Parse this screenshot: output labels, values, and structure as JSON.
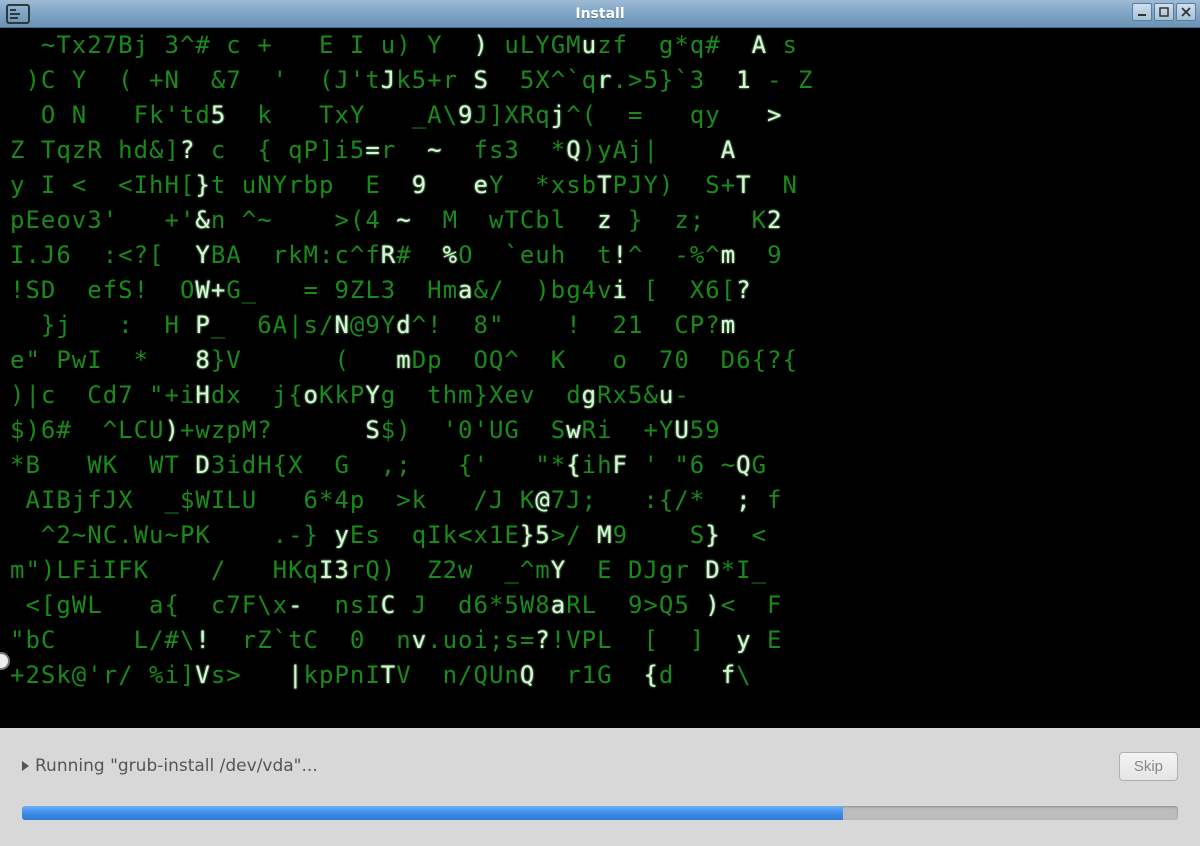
{
  "window": {
    "title": "Install",
    "app_icon_label": "app-icon"
  },
  "window_controls": {
    "minimize": "minimize",
    "maximize": "maximize",
    "close": "close"
  },
  "matrix_rows": [
    {
      "segs": [
        {
          "t": "  ~Tx27Bj 3^# c +   E I u) Y  ",
          "c": "mg"
        },
        {
          "t": ")",
          "c": "mb"
        },
        {
          "t": " uLYGM",
          "c": "mg"
        },
        {
          "t": "u",
          "c": "mb"
        },
        {
          "t": "zf  g*q# ",
          "c": "mg"
        },
        {
          "t": " A",
          "c": "mb"
        },
        {
          "t": " s",
          "c": "mg"
        }
      ]
    },
    {
      "segs": [
        {
          "t": " )C Y  ( +N  &7  '  (J't",
          "c": "mg"
        },
        {
          "t": "J",
          "c": "mb"
        },
        {
          "t": "k5+r ",
          "c": "mg"
        },
        {
          "t": "S",
          "c": "mb"
        },
        {
          "t": "  5X^`q",
          "c": "mg"
        },
        {
          "t": "r",
          "c": "mb"
        },
        {
          "t": ".>5}`3 ",
          "c": "mg"
        },
        {
          "t": " 1",
          "c": "mb"
        },
        {
          "t": " - Z",
          "c": "mg"
        }
      ]
    },
    {
      "segs": [
        {
          "t": "  O N   Fk'td",
          "c": "mg"
        },
        {
          "t": "5",
          "c": "mb"
        },
        {
          "t": "  k   TxY   _A\\",
          "c": "mg"
        },
        {
          "t": "9",
          "c": "mb"
        },
        {
          "t": "J]XRq",
          "c": "mg"
        },
        {
          "t": "j",
          "c": "mb"
        },
        {
          "t": "^(  =   qy  ",
          "c": "mg"
        },
        {
          "t": " >",
          "c": "mb"
        }
      ]
    },
    {
      "segs": [
        {
          "t": "Z TqzR hd&]",
          "c": "mg"
        },
        {
          "t": "?",
          "c": "mb"
        },
        {
          "t": " c  { qP]i5",
          "c": "mg"
        },
        {
          "t": "=",
          "c": "mb"
        },
        {
          "t": "r  ",
          "c": "mg"
        },
        {
          "t": "~",
          "c": "mb"
        },
        {
          "t": "  fs3  *",
          "c": "mg"
        },
        {
          "t": "Q",
          "c": "mb"
        },
        {
          "t": ")yAj|   ",
          "c": "mg"
        },
        {
          "t": " A",
          "c": "mb"
        }
      ]
    },
    {
      "segs": [
        {
          "t": "y I <  <IhH[",
          "c": "mg"
        },
        {
          "t": "}",
          "c": "mb"
        },
        {
          "t": "t uNYrbp  E  ",
          "c": "mg"
        },
        {
          "t": "9",
          "c": "mb"
        },
        {
          "t": "   ",
          "c": "mg"
        },
        {
          "t": "e",
          "c": "mb"
        },
        {
          "t": "Y  *xsb",
          "c": "mg"
        },
        {
          "t": "T",
          "c": "mb"
        },
        {
          "t": "PJY)  S+",
          "c": "mg"
        },
        {
          "t": "T",
          "c": "mb"
        },
        {
          "t": "  N",
          "c": "mg"
        }
      ]
    },
    {
      "segs": [
        {
          "t": "pEeov3'   +'",
          "c": "mg"
        },
        {
          "t": "&",
          "c": "mb"
        },
        {
          "t": "n ^~    >(4 ",
          "c": "mg"
        },
        {
          "t": "~",
          "c": "mb"
        },
        {
          "t": "  M  wTCbl  ",
          "c": "mg"
        },
        {
          "t": "z",
          "c": "mb"
        },
        {
          "t": " }  z;   K",
          "c": "mg"
        },
        {
          "t": "2",
          "c": "mb"
        }
      ]
    },
    {
      "segs": [
        {
          "t": "I.J6  :<?[  ",
          "c": "mg"
        },
        {
          "t": "Y",
          "c": "mb"
        },
        {
          "t": "BA  rkM:c^f",
          "c": "mg"
        },
        {
          "t": "R",
          "c": "mb"
        },
        {
          "t": "#  ",
          "c": "mg"
        },
        {
          "t": "%",
          "c": "mb"
        },
        {
          "t": "O  `euh  t",
          "c": "mg"
        },
        {
          "t": "!",
          "c": "mb"
        },
        {
          "t": "^  -%^",
          "c": "mg"
        },
        {
          "t": "m",
          "c": "mb"
        },
        {
          "t": "  9",
          "c": "mg"
        }
      ]
    },
    {
      "segs": [
        {
          "t": "!SD  efS!  O",
          "c": "mg"
        },
        {
          "t": "W+",
          "c": "mb"
        },
        {
          "t": "G_   = 9ZL3  Hm",
          "c": "mg"
        },
        {
          "t": "a",
          "c": "mb"
        },
        {
          "t": "&/  )bg4v",
          "c": "mg"
        },
        {
          "t": "i",
          "c": "mb"
        },
        {
          "t": " [  X6[",
          "c": "mg"
        },
        {
          "t": "?",
          "c": "mb"
        }
      ]
    },
    {
      "segs": [
        {
          "t": "  }j   :  H ",
          "c": "mg"
        },
        {
          "t": "P",
          "c": "mb"
        },
        {
          "t": "_  6A|s/",
          "c": "mg"
        },
        {
          "t": "N",
          "c": "mb"
        },
        {
          "t": "@9Y",
          "c": "mg"
        },
        {
          "t": "d",
          "c": "mb"
        },
        {
          "t": "^!  8\"    !  21  CP?",
          "c": "mg"
        },
        {
          "t": "m",
          "c": "mb"
        }
      ]
    },
    {
      "segs": [
        {
          "t": "e\" PwI  *   ",
          "c": "mg"
        },
        {
          "t": "8",
          "c": "mb"
        },
        {
          "t": "}V      (   ",
          "c": "mg"
        },
        {
          "t": "m",
          "c": "mb"
        },
        {
          "t": "Dp  OQ^  K   o  70  D6{?{",
          "c": "mg"
        }
      ]
    },
    {
      "segs": [
        {
          "t": ")|c  Cd7 \"+i",
          "c": "mg"
        },
        {
          "t": "H",
          "c": "mb"
        },
        {
          "t": "dx  j{",
          "c": "mg"
        },
        {
          "t": "o",
          "c": "mb"
        },
        {
          "t": "KkP",
          "c": "mg"
        },
        {
          "t": "Y",
          "c": "mb"
        },
        {
          "t": "g  thm}Xev  d",
          "c": "mg"
        },
        {
          "t": "g",
          "c": "mb"
        },
        {
          "t": "Rx5&",
          "c": "mg"
        },
        {
          "t": "u",
          "c": "mb"
        },
        {
          "t": "-",
          "c": "mg"
        }
      ]
    },
    {
      "segs": [
        {
          "t": "$)6#  ^LCU",
          "c": "mg"
        },
        {
          "t": ")",
          "c": "mb"
        },
        {
          "t": "+wzpM?      ",
          "c": "mg"
        },
        {
          "t": "S",
          "c": "mb"
        },
        {
          "t": "$)  '0'UG  S",
          "c": "mg"
        },
        {
          "t": "w",
          "c": "mb"
        },
        {
          "t": "Ri  +Y",
          "c": "mg"
        },
        {
          "t": "U",
          "c": "mb"
        },
        {
          "t": "59",
          "c": "mg"
        }
      ]
    },
    {
      "segs": [
        {
          "t": "*B   WK  WT ",
          "c": "mg"
        },
        {
          "t": "D",
          "c": "mb"
        },
        {
          "t": "3idH{X  G  ,;   {'   \"*",
          "c": "mg"
        },
        {
          "t": "{",
          "c": "mb"
        },
        {
          "t": "ih",
          "c": "mg"
        },
        {
          "t": "F",
          "c": "mb"
        },
        {
          "t": " ' \"6 ~",
          "c": "mg"
        },
        {
          "t": "Q",
          "c": "mb"
        },
        {
          "t": "G",
          "c": "mg"
        }
      ]
    },
    {
      "segs": [
        {
          "t": " AIBjfJX  _$WILU   6*4p  >k   /J K",
          "c": "mg"
        },
        {
          "t": "@",
          "c": "mb"
        },
        {
          "t": "7J;   :{/*  ",
          "c": "mg"
        },
        {
          "t": ";",
          "c": "mb"
        },
        {
          "t": " f",
          "c": "mg"
        }
      ]
    },
    {
      "segs": [
        {
          "t": "  ^2~NC.Wu~PK    .-} ",
          "c": "mg"
        },
        {
          "t": "y",
          "c": "mb"
        },
        {
          "t": "Es  qIk<x1E",
          "c": "mg"
        },
        {
          "t": "}",
          "c": "mb"
        },
        {
          "t": "5",
          "c": "mb"
        },
        {
          "t": ">/ ",
          "c": "mg"
        },
        {
          "t": "M",
          "c": "mb"
        },
        {
          "t": "9    S",
          "c": "mg"
        },
        {
          "t": "}",
          "c": "mb"
        },
        {
          "t": "  <",
          "c": "mg"
        }
      ]
    },
    {
      "segs": [
        {
          "t": "m\")LFiIFK    /   HKq",
          "c": "mg"
        },
        {
          "t": "I3",
          "c": "mb"
        },
        {
          "t": "rQ)  Z2w  _^m",
          "c": "mg"
        },
        {
          "t": "Y",
          "c": "mb"
        },
        {
          "t": "  E DJgr ",
          "c": "mg"
        },
        {
          "t": "D",
          "c": "mb"
        },
        {
          "t": "*I_",
          "c": "mg"
        }
      ]
    },
    {
      "segs": [
        {
          "t": " <[gWL   a{  c7F\\x",
          "c": "mg"
        },
        {
          "t": "-",
          "c": "mb"
        },
        {
          "t": "  nsI",
          "c": "mg"
        },
        {
          "t": "C",
          "c": "mb"
        },
        {
          "t": " J  d6*5W8",
          "c": "mg"
        },
        {
          "t": "a",
          "c": "mb"
        },
        {
          "t": "RL  9>Q5 ",
          "c": "mg"
        },
        {
          "t": ")",
          "c": "mb"
        },
        {
          "t": "<  F",
          "c": "mg"
        }
      ]
    },
    {
      "segs": [
        {
          "t": "\"bC     L/#\\",
          "c": "mg"
        },
        {
          "t": "!",
          "c": "mb"
        },
        {
          "t": "  rZ`tC  0  n",
          "c": "mg"
        },
        {
          "t": "v",
          "c": "mb"
        },
        {
          "t": ".uoi;s=",
          "c": "mg"
        },
        {
          "t": "?",
          "c": "mb"
        },
        {
          "t": "!VPL  [  ]  ",
          "c": "mg"
        },
        {
          "t": "y",
          "c": "mb"
        },
        {
          "t": " E",
          "c": "mg"
        }
      ]
    },
    {
      "segs": [
        {
          "t": "+2Sk@'r/ %i]",
          "c": "mg"
        },
        {
          "t": "V",
          "c": "mb"
        },
        {
          "t": "s>   ",
          "c": "mg"
        },
        {
          "t": "|",
          "c": "mb"
        },
        {
          "t": "kpPnI",
          "c": "mg"
        },
        {
          "t": "T",
          "c": "mb"
        },
        {
          "t": "V  n/QUn",
          "c": "mg"
        },
        {
          "t": "Q",
          "c": "mb"
        },
        {
          "t": "  r1G  ",
          "c": "mg"
        },
        {
          "t": "{",
          "c": "mb"
        },
        {
          "t": "d   ",
          "c": "mg"
        },
        {
          "t": "f",
          "c": "mb"
        },
        {
          "t": "\\",
          "c": "mg"
        }
      ]
    }
  ],
  "status": {
    "text": "Running \"grub-install /dev/vda\"...",
    "skip_label": "Skip",
    "progress_percent": 71
  }
}
